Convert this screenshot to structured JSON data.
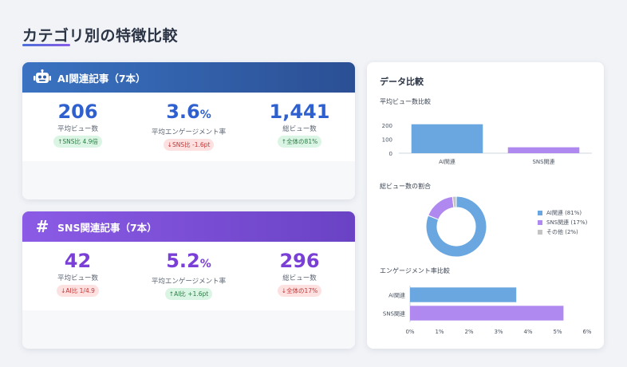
{
  "page": {
    "title": "カテゴリ別の特徴比較"
  },
  "ai_card": {
    "title": "AI関連記事（7本）",
    "icon": "robot-icon",
    "color": "#2f60d0",
    "stats": [
      {
        "value": "206",
        "unit": "",
        "label": "平均ビュー数",
        "badge": "SNS比 4.9倍",
        "trend": "up"
      },
      {
        "value": "3.6",
        "unit": "%",
        "label": "平均エンゲージメント率",
        "badge": "SNS比 -1.6pt",
        "trend": "down"
      },
      {
        "value": "1,441",
        "unit": "",
        "label": "総ビュー数",
        "badge": "全体の81%",
        "trend": "up"
      }
    ]
  },
  "sns_card": {
    "title": "SNS関連記事（7本）",
    "icon": "hash-icon",
    "hash_glyph": "#",
    "color": "#7a3fd6",
    "stats": [
      {
        "value": "42",
        "unit": "",
        "label": "平均ビュー数",
        "badge": "AI比 1/4.9",
        "trend": "down"
      },
      {
        "value": "5.2",
        "unit": "%",
        "label": "平均エンゲージメント率",
        "badge": "AI比 +1.6pt",
        "trend": "up"
      },
      {
        "value": "296",
        "unit": "",
        "label": "総ビュー数",
        "badge": "全体の17%",
        "trend": "down"
      }
    ]
  },
  "data_panel": {
    "title": "データ比較",
    "sections": {
      "views": "平均ビュー数比較",
      "share": "総ビュー数の割合",
      "engagement": "エンゲージメント率比較"
    }
  },
  "chart_data": [
    {
      "type": "bar",
      "title": "平均ビュー数比較",
      "categories": [
        "AI関連",
        "SNS関連"
      ],
      "values": [
        206,
        42
      ],
      "ylim": [
        0,
        250
      ],
      "yticks": [
        0,
        100,
        200
      ],
      "colors": [
        "#6aa6df",
        "#b089f0"
      ]
    },
    {
      "type": "pie",
      "title": "総ビュー数の割合",
      "labels": [
        "AI関連 (81%)",
        "SNS関連 (17%)",
        "その他 (2%)"
      ],
      "values": [
        81,
        17,
        2
      ],
      "colors": [
        "#6aa6df",
        "#b089f0",
        "#c4c4c4"
      ],
      "legend": "right"
    },
    {
      "type": "bar",
      "orientation": "horizontal",
      "title": "エンゲージメント率比較",
      "categories": [
        "AI関連",
        "SNS関連"
      ],
      "values": [
        3.6,
        5.2
      ],
      "xlim": [
        0,
        6
      ],
      "xticks": [
        "0%",
        "1%",
        "2%",
        "3%",
        "4%",
        "5%",
        "6%"
      ],
      "colors": [
        "#6aa6df",
        "#b089f0"
      ]
    }
  ]
}
